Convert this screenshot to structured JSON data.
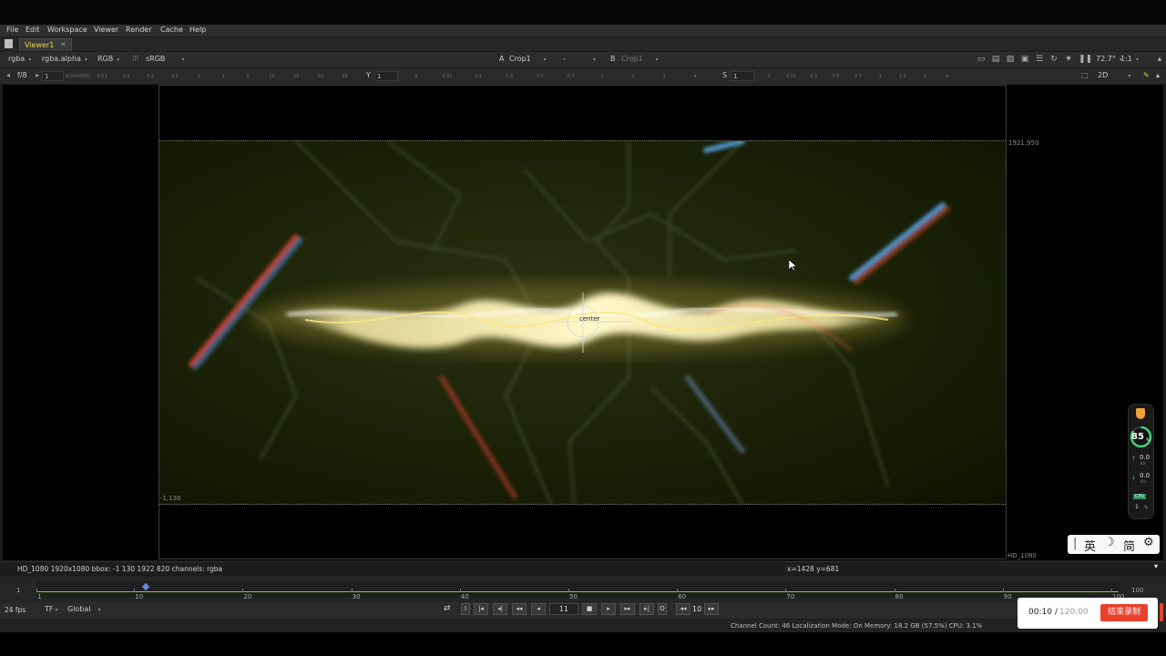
{
  "menubar": {
    "items": [
      "File",
      "Edit",
      "Workspace",
      "Viewer",
      "Render",
      "Cache",
      "Help"
    ]
  },
  "tab": {
    "label": "Viewer1",
    "close": "×"
  },
  "toolbar1": {
    "channels": "rgba",
    "alpha": "rgba.alpha",
    "display_channel": "RGB",
    "ip": "IP",
    "lut": "sRGB",
    "input_a_label": "A",
    "input_a": "Crop1",
    "compare": "-",
    "input_b_label": "B",
    "input_b": "Crop1",
    "zoom": "72.7°",
    "ratio": "1:1"
  },
  "toolbar2": {
    "fstop": "f/8",
    "gain": "1",
    "y_label": "Y",
    "gamma": "1",
    "s_label": "S",
    "saturation": "1",
    "view_mode": "2D",
    "ruler_gain": [
      "0.0000000",
      "0.03",
      "0.1",
      "0.2",
      "0.5",
      "1",
      "2",
      "5",
      "10",
      "20",
      "50",
      "99"
    ],
    "ruler_gamma": [
      "0",
      "0.01",
      "0.1",
      "0.3",
      "0.5",
      "0.7",
      "1",
      "2",
      "3",
      "4"
    ],
    "ruler_sat": [
      "0",
      "0.01",
      "0.3",
      "0.5",
      "0.7",
      "1",
      "1.5",
      "2",
      "4"
    ]
  },
  "viewer": {
    "top_right_coord": "1921,950",
    "bottom_left_coord": "-1,130",
    "format_label": "HD_1080",
    "center_label": "center"
  },
  "infobar": {
    "info": "HD_1080 1920x1080  bbox: -1 130 1922 820 channels: rgba",
    "cursor": "x=1428 y=681"
  },
  "timeline": {
    "start": "1",
    "end": "100",
    "ticks": [
      "1",
      "10",
      "20",
      "30",
      "40",
      "50",
      "60",
      "70",
      "80",
      "90",
      "100"
    ],
    "current_frame": 11
  },
  "playbar": {
    "fps": "24 fps",
    "tf": "TF",
    "scope": "Global",
    "frame": "11",
    "increment": "10"
  },
  "statusbar": {
    "text": "Channel Count: 46  Localization Mode: On  Memory: 18.2 GB (57.5%)  CPU: 3.1%"
  },
  "gauge": {
    "percent": "85",
    "percent_unit": "%",
    "up_value": "0.0",
    "up_unit": "K/s",
    "down_value": "0.0",
    "down_unit": "K/s",
    "cpu_label": "CPU",
    "cpu_value": "1",
    "cpu_unit": "%"
  },
  "ime": {
    "lang": "英",
    "script": "简"
  },
  "recording": {
    "elapsed": "00:10",
    "separator": " / ",
    "total": "120:00",
    "stop_label": "结束录制"
  },
  "colors": {
    "accent": "#e8d84a",
    "timeline_green": "#7fd13a",
    "record_red": "#e8412c"
  }
}
